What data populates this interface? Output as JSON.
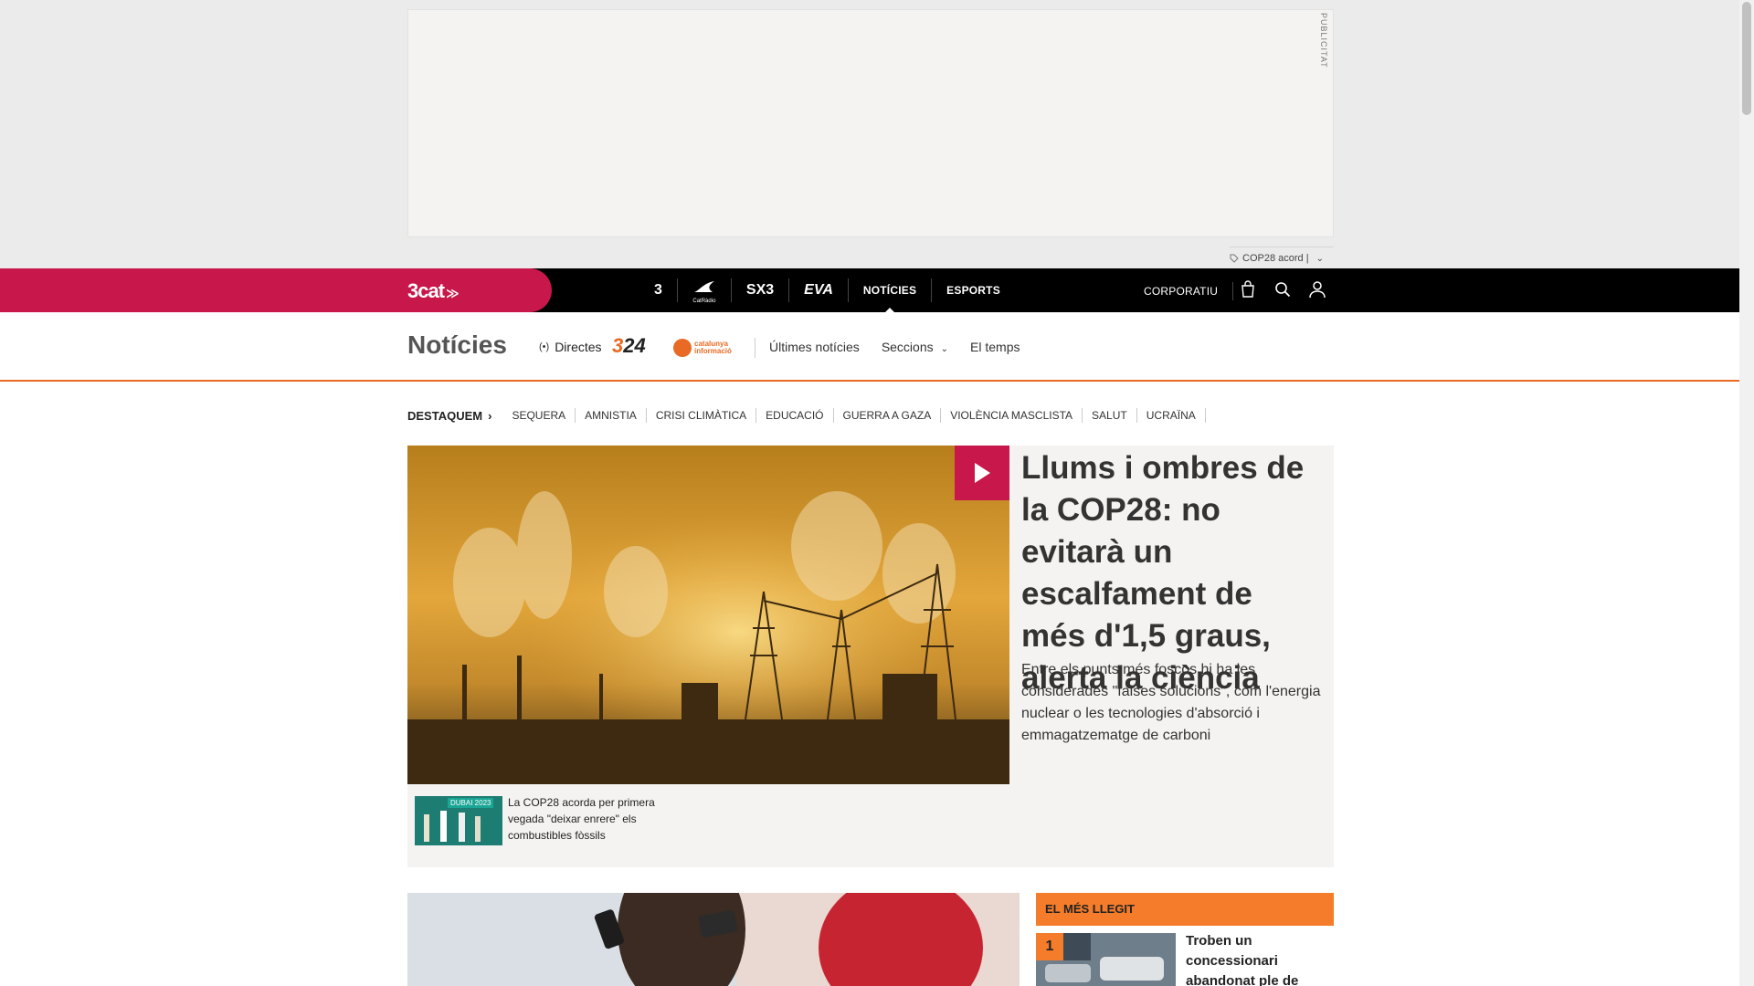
{
  "ad": {
    "label": "PUBLICITAT",
    "ticker_text": "COP28 acord |"
  },
  "topnav": {
    "brand": "3cat",
    "channels": [
      {
        "label": "3",
        "icon": "tv3-logo-icon"
      },
      {
        "label": "CatRàdio",
        "icon": "catradio-logo-icon"
      },
      {
        "label": "SX3",
        "icon": "sx3-logo-icon"
      },
      {
        "label": "EVA",
        "icon": "eva-logo-icon"
      },
      {
        "label": "NOTÍCIES",
        "active": true
      },
      {
        "label": "ESPORTS"
      }
    ],
    "corporate": "CORPORATIU",
    "icons": [
      "shop-bag-icon",
      "search-icon",
      "user-icon"
    ]
  },
  "section": {
    "title": "Notícies",
    "directes": "Directes",
    "logo_324": "324",
    "logo_ci": "catalunya informació",
    "subnav": [
      "Últimes notícies",
      "Seccions",
      "El temps"
    ]
  },
  "highlights": {
    "lead": "DESTAQUEM",
    "tags": [
      "SEQUERA",
      "AMNISTIA",
      "CRISI CLIMÀTICA",
      "EDUCACIÓ",
      "GUERRA A GAZA",
      "VIOLÈNCIA MASCLISTA",
      "SALUT",
      "UCRAÏNA"
    ]
  },
  "hero": {
    "title": "Llums i ombres de la COP28: no evitarà un escalfament de més d'1,5 graus, alerta la ciència",
    "summary": "Entre els punts més foscos hi ha les considerades \"falses solucions\", com l'energia nuclear o les tecnologies d'absorció i emmagatzematge de carboni",
    "related": {
      "banner": "DUBAI 2023",
      "text": "La COP28 acorda per primera vegada \"deixar enrere\" els combustibles fòssils"
    }
  },
  "most_read": {
    "title": "EL MÉS LLEGIT",
    "items": [
      {
        "rank": "1",
        "text": "Troben un concessionari abandonat ple de"
      }
    ]
  },
  "colors": {
    "brand_red": "#c8174a",
    "accent_orange": "#f47c2a",
    "nav_black": "#000000"
  }
}
